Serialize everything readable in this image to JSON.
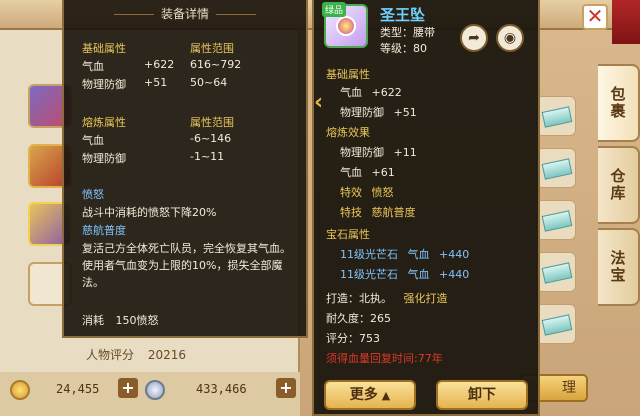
{
  "detail": {
    "title": "装备详情",
    "base_header": "基础属性",
    "base_range_header": "属性范围",
    "base_rows": [
      {
        "name": "气血",
        "value": "+622",
        "range": "616~792"
      },
      {
        "name": "物理防御",
        "value": "+51",
        "range": "50~64"
      }
    ],
    "refine_header": "熔炼属性",
    "refine_range_header": "属性范围",
    "refine_rows": [
      {
        "name": "气血",
        "range": "-6~146"
      },
      {
        "name": "物理防御",
        "range": "-1~11"
      }
    ],
    "anger_header": "愤怒",
    "anger_desc": "战斗中消耗的愤怒下降20%",
    "skill_name": "慈航普度",
    "skill_desc": "复活己方全体死亡队员，完全恢复其气血。使用者气血变为上限的10%，损失全部魔法。",
    "cost_label": "消耗",
    "cost_value": "150愤怒"
  },
  "item": {
    "badge": "绿品",
    "name": "圣王坠",
    "type_label": "类型：腰带",
    "level_label": "等级：80",
    "base_header": "基础属性",
    "base_rows": [
      {
        "name": "气血",
        "value": "+622"
      },
      {
        "name": "物理防御",
        "value": "+51"
      }
    ],
    "refine_header": "熔炼效果",
    "refine_rows": [
      {
        "name": "物理防御",
        "value": "+11"
      },
      {
        "name": "气血",
        "value": "+61"
      }
    ],
    "effect_label": "特效",
    "effect_value": "愤怒",
    "skill_label": "特技",
    "skill_value": "慈航普度",
    "gem_header": "宝石属性",
    "gem_rows": [
      {
        "gem": "11级光芒石",
        "name": "气血",
        "value": "+440"
      },
      {
        "gem": "11级光芒石",
        "name": "气血",
        "value": "+440"
      }
    ],
    "maker": "打造：北执。",
    "maker_extra": "强化打造",
    "durability": "耐久度：265",
    "score": "评分：753",
    "warning": "须得血量回复时间:77年",
    "more_button": "更多",
    "unload_button": "卸下"
  },
  "background": {
    "score_label": "人物评分",
    "score_value": "20216",
    "gold": "24,455",
    "silver": "433,466",
    "manage_button": "理",
    "tabs": [
      "包裹",
      "仓库",
      "法宝"
    ]
  },
  "icons": [
    "share-icon",
    "eye-icon",
    "close-icon",
    "gold-coin-icon",
    "silver-coin-icon"
  ]
}
